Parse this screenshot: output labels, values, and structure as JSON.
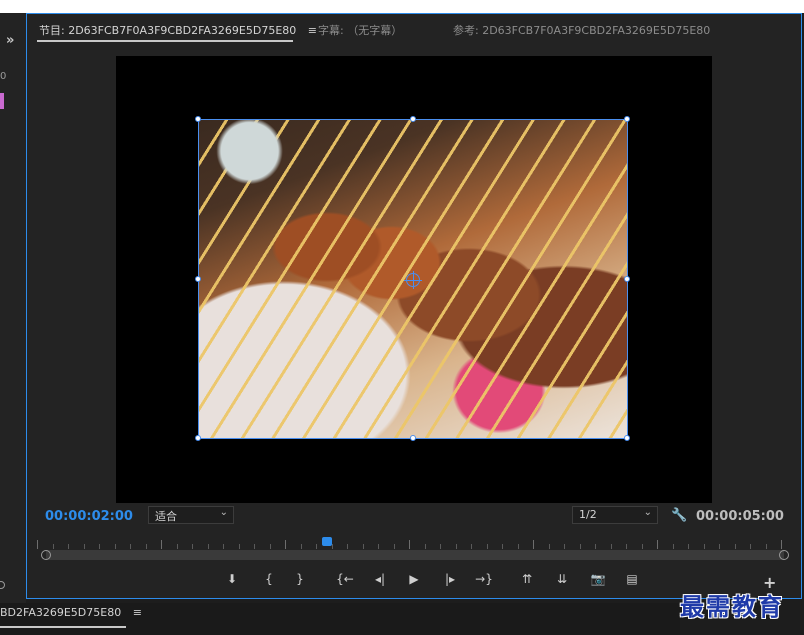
{
  "left_column": {
    "expand_icon": "chevron-double-right",
    "fragment_text": "0"
  },
  "tabs": [
    {
      "label": "节目: 2D63FCB7F0A3F9CBD2FA3269E5D75E80",
      "active": true,
      "menu_icon": "≡"
    },
    {
      "label": "字幕: （无字幕）",
      "active": false
    },
    {
      "label": "参考: 2D63FCB7F0A3F9CBD2FA3269E5D75E80",
      "active": false
    }
  ],
  "viewer": {
    "image_subject": "grilled meat skewers",
    "current_time": "00:00:02:00",
    "duration": "00:00:05:00",
    "fit_select": {
      "value": "适合"
    },
    "resolution_select": {
      "value": "1/2"
    },
    "settings_icon": "wrench-icon"
  },
  "controls": [
    {
      "name": "add-marker-button",
      "glyph": "⬇"
    },
    {
      "name": "mark-in-button",
      "glyph": "{"
    },
    {
      "name": "mark-out-button",
      "glyph": "}"
    },
    {
      "name": "go-to-in-button",
      "glyph": "{←"
    },
    {
      "name": "step-back-button",
      "glyph": "◂|"
    },
    {
      "name": "play-button",
      "glyph": "▶"
    },
    {
      "name": "step-forward-button",
      "glyph": "|▸"
    },
    {
      "name": "go-to-out-button",
      "glyph": "→}"
    },
    {
      "name": "lift-button",
      "glyph": "⇈"
    },
    {
      "name": "extract-button",
      "glyph": "⇊"
    },
    {
      "name": "export-frame-button",
      "glyph": "📷"
    },
    {
      "name": "comparison-view-button",
      "glyph": "▤"
    }
  ],
  "add_button": "+",
  "bottom_tab": {
    "label": "BD2FA3269E5D75E80",
    "menu_icon": "≡"
  },
  "watermark": "最需教育",
  "colors": {
    "accent": "#2d8ceb",
    "panel_bg": "#232323",
    "watermark": "#1f3aa8"
  }
}
